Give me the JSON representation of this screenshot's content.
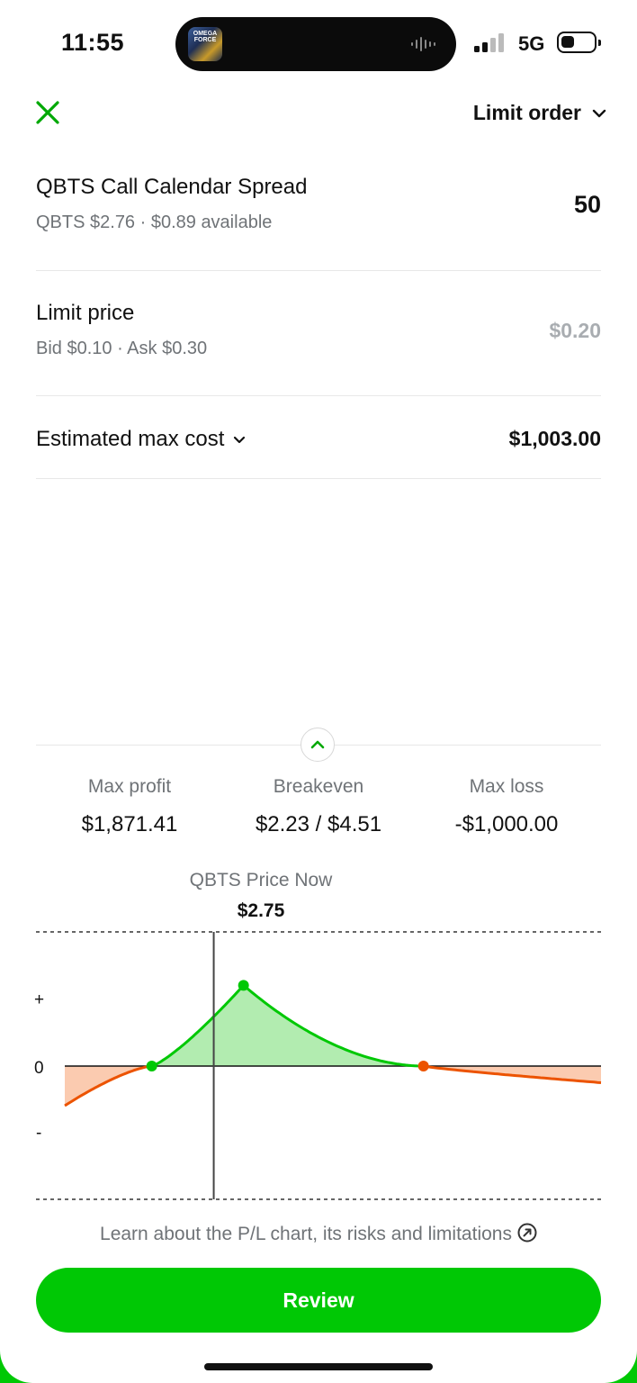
{
  "status_bar": {
    "time": "11:55",
    "network": "5G",
    "thumb_text": "OMEGA FORCE"
  },
  "header": {
    "order_type": "Limit order"
  },
  "position": {
    "title": "QBTS Call Calendar Spread",
    "subtitle": "QBTS $2.76 · $0.89 available",
    "quantity": "50"
  },
  "limit": {
    "title": "Limit price",
    "subtitle": "Bid $0.10 · Ask $0.30",
    "value": "$0.20"
  },
  "estimate": {
    "label": "Estimated max cost",
    "value": "$1,003.00"
  },
  "summary": {
    "max_profit_label": "Max profit",
    "max_profit": "$1,871.41",
    "breakeven_label": "Breakeven",
    "breakeven": "$2.23 / $4.51",
    "max_loss_label": "Max loss",
    "max_loss": "-$1,000.00"
  },
  "chart_data": {
    "type": "area",
    "title": "QBTS Price Now",
    "current_price_label": "$2.75",
    "y_tick_labels": [
      "+",
      "0",
      "-"
    ],
    "breakevens": [
      2.23,
      4.51
    ],
    "current_price": 2.75,
    "x_range": [
      1.5,
      6.0
    ],
    "y_range": [
      -2000,
      2400
    ],
    "colors": {
      "profit": "#00c805",
      "profit_fill": "#b2ecb0",
      "loss": "#ec5300",
      "loss_fill": "#fbcbb0"
    }
  },
  "learn_text": "Learn about the P/L chart, its risks and limitations",
  "review_label": "Review"
}
